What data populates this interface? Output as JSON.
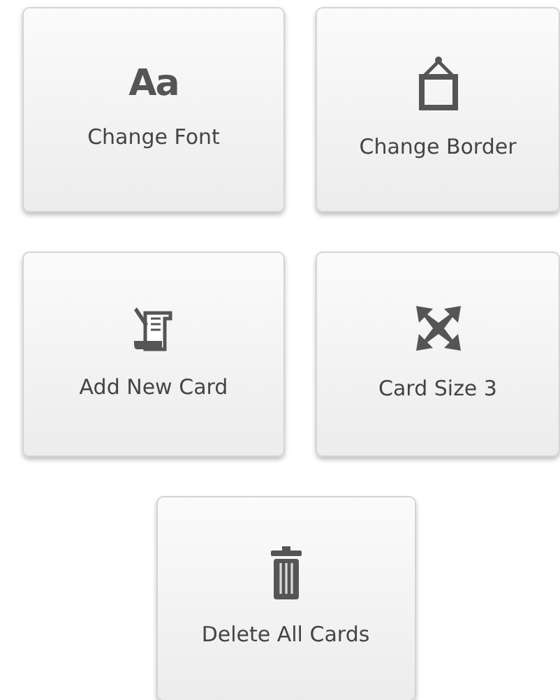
{
  "buttons": [
    {
      "kind": "font",
      "glyph": "Aa",
      "label": "Change Font"
    },
    {
      "kind": "border",
      "label": "Change Border"
    },
    {
      "kind": "add",
      "label": "Add New Card"
    },
    {
      "kind": "resize",
      "label": "Card Size 3"
    },
    {
      "kind": "delete",
      "label": "Delete All Cards"
    }
  ]
}
